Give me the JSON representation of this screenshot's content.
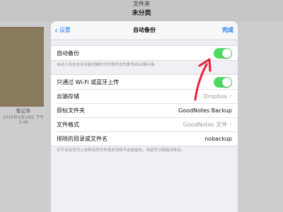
{
  "background": {
    "top_bar_prev": "文件夹",
    "top_bar_title": "未分类",
    "notebook_title": "笔记本",
    "notebook_date": "2016年4月16日 下午2:48"
  },
  "modal": {
    "nav": {
      "back_label": "设置",
      "title": "自动备份",
      "done_label": "完成"
    },
    "auto_backup": {
      "label": "自动备份",
      "enabled": true,
      "footer": "自动上传在这台设备创建的文件和作出的更改到云端存储。"
    },
    "settings": [
      {
        "label": "只通过 Wi-Fi 或蓝牙上传",
        "type": "toggle",
        "enabled": true
      },
      {
        "label": "云端存储",
        "type": "value",
        "value": "Dropbox",
        "muted": true,
        "chevron": true
      },
      {
        "label": "目标文件夹",
        "type": "value",
        "value": "GoodNotes Backup",
        "muted": false,
        "chevron": false
      },
      {
        "label": "文件格式",
        "type": "value",
        "value": "GoodNotes 文件",
        "muted": true,
        "chevron": true
      },
      {
        "label": "排除的目录或文件名",
        "type": "value",
        "value": "nobackup",
        "muted": false,
        "chevron": false
      }
    ],
    "settings_footer": "名字含有任何上述条目的文件或夹则将不会被备份。用逗号分隔每项条目。"
  },
  "colors": {
    "accent": "#1a7cf5",
    "toggle_on": "#4cd964",
    "annotation_arrow": "#e8223a"
  }
}
